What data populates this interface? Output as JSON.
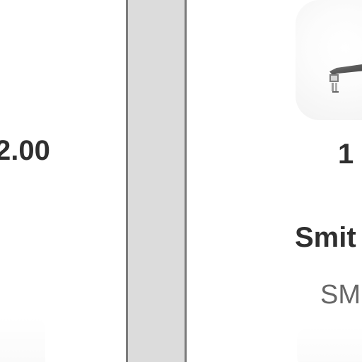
{
  "left_panel": {
    "value": "2.00"
  },
  "right_panel": {
    "quantity": "1",
    "product_name": "Smit",
    "product_code": "SM"
  },
  "icons": {
    "product_image": "faucet-icon"
  },
  "colors": {
    "divider_fill": "#dcdcdc",
    "divider_border": "#7b7b7b",
    "text_primary": "#2f2f2f",
    "text_secondary": "#666666"
  }
}
